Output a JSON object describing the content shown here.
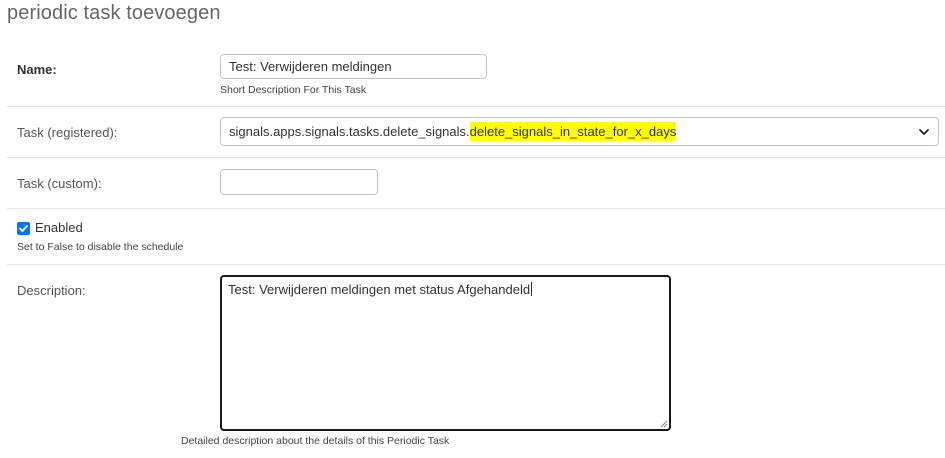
{
  "page": {
    "title": "periodic task toevoegen"
  },
  "form": {
    "name": {
      "label": "Name:",
      "value": "Test: Verwijderen meldingen",
      "help": "Short Description For This Task"
    },
    "task_registered": {
      "label": "Task (registered):",
      "selected_prefix": "signals.apps.signals.tasks.delete_signals.",
      "selected_highlight": "delete_signals_in_state_for_x_days",
      "highlight_color": "#ffff00"
    },
    "task_custom": {
      "label": "Task (custom):",
      "value": ""
    },
    "enabled": {
      "label": "Enabled",
      "checked": true,
      "help": "Set to False to disable the schedule",
      "check_color": "#0075ff"
    },
    "description": {
      "label": "Description:",
      "value": "Test: Verwijderen meldingen met status Afgehandeld",
      "help": "Detailed description about the details of this Periodic Task"
    }
  },
  "icons": {
    "select_arrow": "chevron-down-icon",
    "checkbox_mark": "checkmark-icon",
    "textarea_resize": "resize-grip-icon"
  }
}
